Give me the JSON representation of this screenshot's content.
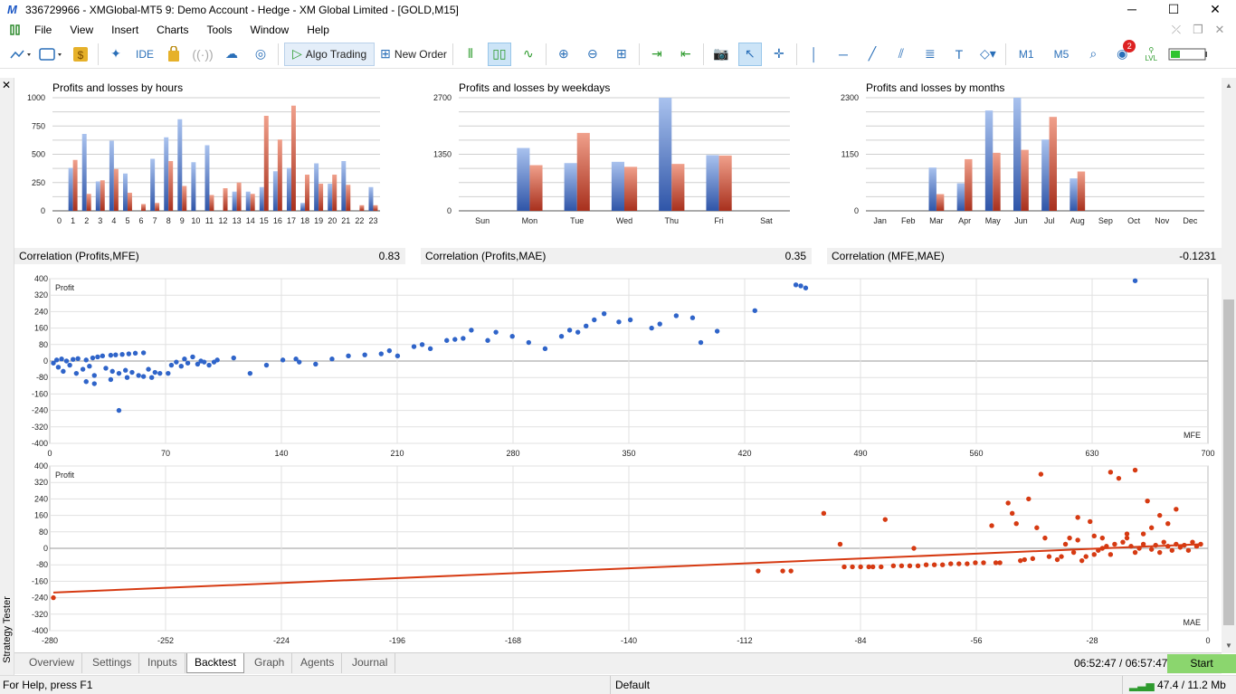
{
  "window": {
    "title": "336729966 - XMGlobal-MT5 9: Demo Account - Hedge - XM Global Limited - [GOLD,M15]",
    "controls": [
      "─",
      "☐",
      "✕"
    ]
  },
  "menu": [
    "File",
    "View",
    "Insert",
    "Charts",
    "Tools",
    "Window",
    "Help"
  ],
  "toolbar": {
    "ide": "IDE",
    "algo_trading": "Algo Trading",
    "new_order": "New Order",
    "tf1": "M1",
    "tf2": "M5",
    "notif_count": "2",
    "lvl": "LVL"
  },
  "colors": {
    "blue": "#3f6bc4",
    "red": "#c0442a",
    "scatter_blue": "#2f64c9",
    "scatter_red": "#d63a12"
  },
  "hours": {
    "title": "Profits and losses by hours",
    "yticks": [
      "1000",
      "750",
      "500",
      "250",
      "0"
    ],
    "xticks": [
      "0",
      "1",
      "2",
      "3",
      "4",
      "5",
      "6",
      "7",
      "8",
      "9",
      "10",
      "11",
      "12",
      "13",
      "14",
      "15",
      "16",
      "17",
      "18",
      "19",
      "20",
      "21",
      "22",
      "23"
    ],
    "ymax": 1000,
    "profit": [
      0,
      380,
      680,
      260,
      620,
      330,
      0,
      460,
      650,
      810,
      430,
      580,
      0,
      170,
      170,
      210,
      350,
      380,
      70,
      420,
      240,
      440,
      0,
      210
    ],
    "loss": [
      0,
      450,
      150,
      270,
      370,
      160,
      60,
      70,
      440,
      220,
      0,
      140,
      200,
      250,
      150,
      840,
      630,
      930,
      320,
      240,
      320,
      230,
      50,
      50
    ]
  },
  "weekdays": {
    "title": "Profits and losses by weekdays",
    "yticks": [
      "2700",
      "1350",
      "0"
    ],
    "xticks": [
      "Sun",
      "Mon",
      "Tue",
      "Wed",
      "Thu",
      "Fri",
      "Sat"
    ],
    "ymax": 2700,
    "profit": [
      0,
      1500,
      1140,
      1170,
      2700,
      1330,
      0
    ],
    "loss": [
      0,
      1090,
      1860,
      1050,
      1120,
      1320,
      0
    ]
  },
  "months": {
    "title": "Profits and losses by months",
    "yticks": [
      "2300",
      "1150",
      "0"
    ],
    "xticks": [
      "Jan",
      "Feb",
      "Mar",
      "Apr",
      "May",
      "Jun",
      "Jul",
      "Aug",
      "Sep",
      "Oct",
      "Nov",
      "Dec"
    ],
    "ymax": 2300,
    "profit": [
      0,
      0,
      880,
      560,
      2040,
      2300,
      1450,
      660,
      0,
      0,
      0,
      0
    ],
    "loss": [
      0,
      0,
      340,
      1050,
      1180,
      1240,
      1910,
      800,
      0,
      0,
      0,
      0
    ]
  },
  "correlations": [
    {
      "label": "Correlation (Profits,MFE)",
      "value": "0.83"
    },
    {
      "label": "Correlation (Profits,MAE)",
      "value": "0.35"
    },
    {
      "label": "Correlation (MFE,MAE)",
      "value": "-0.1231"
    }
  ],
  "mfe_chart": {
    "ylabel": "Profit",
    "xlabel": "MFE",
    "yticks": [
      "400",
      "320",
      "240",
      "160",
      "80",
      "0",
      "-80",
      "-160",
      "-240",
      "-320",
      "-400"
    ],
    "xticks": [
      "0",
      "70",
      "140",
      "210",
      "280",
      "350",
      "420",
      "490",
      "560",
      "630",
      "700"
    ]
  },
  "mae_chart": {
    "ylabel": "Profit",
    "xlabel": "MAE",
    "yticks": [
      "400",
      "320",
      "240",
      "160",
      "80",
      "0",
      "-80",
      "-160",
      "-240",
      "-320",
      "-400"
    ],
    "xticks": [
      "-280",
      "-252",
      "-224",
      "-196",
      "-168",
      "-140",
      "-112",
      "-84",
      "-56",
      "-28",
      "0"
    ]
  },
  "chart_data": [
    {
      "type": "bar",
      "title": "Profits and losses by hours",
      "categories": [
        "0",
        "1",
        "2",
        "3",
        "4",
        "5",
        "6",
        "7",
        "8",
        "9",
        "10",
        "11",
        "12",
        "13",
        "14",
        "15",
        "16",
        "17",
        "18",
        "19",
        "20",
        "21",
        "22",
        "23"
      ],
      "ylim": [
        0,
        1000
      ],
      "series": [
        {
          "values": [
            0,
            380,
            680,
            260,
            620,
            330,
            0,
            460,
            650,
            810,
            430,
            580,
            0,
            170,
            170,
            210,
            350,
            380,
            70,
            420,
            240,
            440,
            0,
            210
          ]
        },
        {
          "values": [
            0,
            450,
            150,
            270,
            370,
            160,
            60,
            70,
            440,
            220,
            0,
            140,
            200,
            250,
            150,
            840,
            630,
            930,
            320,
            240,
            320,
            230,
            50,
            50
          ]
        }
      ]
    },
    {
      "type": "bar",
      "title": "Profits and losses by weekdays",
      "categories": [
        "Sun",
        "Mon",
        "Tue",
        "Wed",
        "Thu",
        "Fri",
        "Sat"
      ],
      "ylim": [
        0,
        2700
      ],
      "series": [
        {
          "values": [
            0,
            1500,
            1140,
            1170,
            2700,
            1330,
            0
          ]
        },
        {
          "values": [
            0,
            1090,
            1860,
            1050,
            1120,
            1320,
            0
          ]
        }
      ]
    },
    {
      "type": "bar",
      "title": "Profits and losses by months",
      "categories": [
        "Jan",
        "Feb",
        "Mar",
        "Apr",
        "May",
        "Jun",
        "Jul",
        "Aug",
        "Sep",
        "Oct",
        "Nov",
        "Dec"
      ],
      "ylim": [
        0,
        2300
      ],
      "series": [
        {
          "values": [
            0,
            0,
            880,
            560,
            2040,
            2300,
            1450,
            660,
            0,
            0,
            0,
            0
          ]
        },
        {
          "values": [
            0,
            0,
            340,
            1050,
            1180,
            1240,
            1910,
            800,
            0,
            0,
            0,
            0
          ]
        }
      ]
    },
    {
      "type": "scatter",
      "xlabel": "MFE",
      "ylabel": "Profit",
      "xlim": [
        0,
        700
      ],
      "ylim": [
        -400,
        400
      ],
      "points": [
        [
          0,
          -10
        ],
        [
          2,
          5
        ],
        [
          3,
          -30
        ],
        [
          5,
          10
        ],
        [
          6,
          -50
        ],
        [
          8,
          0
        ],
        [
          10,
          -20
        ],
        [
          12,
          8
        ],
        [
          14,
          -60
        ],
        [
          15,
          12
        ],
        [
          18,
          -40
        ],
        [
          20,
          5
        ],
        [
          22,
          -25
        ],
        [
          24,
          15
        ],
        [
          25,
          -70
        ],
        [
          27,
          20
        ],
        [
          30,
          25
        ],
        [
          32,
          -35
        ],
        [
          35,
          28
        ],
        [
          36,
          -50
        ],
        [
          38,
          30
        ],
        [
          40,
          -60
        ],
        [
          42,
          32
        ],
        [
          44,
          -45
        ],
        [
          46,
          35
        ],
        [
          48,
          -55
        ],
        [
          50,
          38
        ],
        [
          52,
          -70
        ],
        [
          55,
          40
        ],
        [
          58,
          -40
        ],
        [
          60,
          -80
        ],
        [
          62,
          -55
        ],
        [
          65,
          -60
        ],
        [
          70,
          -60
        ],
        [
          72,
          -20
        ],
        [
          75,
          -5
        ],
        [
          78,
          -25
        ],
        [
          80,
          10
        ],
        [
          82,
          -10
        ],
        [
          85,
          20
        ],
        [
          88,
          -15
        ],
        [
          90,
          0
        ],
        [
          92,
          -5
        ],
        [
          95,
          -20
        ],
        [
          98,
          -5
        ],
        [
          100,
          5
        ],
        [
          110,
          15
        ],
        [
          120,
          -60
        ],
        [
          130,
          -20
        ],
        [
          140,
          5
        ],
        [
          148,
          10
        ],
        [
          150,
          -5
        ],
        [
          160,
          -15
        ],
        [
          170,
          10
        ],
        [
          180,
          25
        ],
        [
          190,
          30
        ],
        [
          200,
          35
        ],
        [
          205,
          50
        ],
        [
          210,
          25
        ],
        [
          220,
          70
        ],
        [
          225,
          80
        ],
        [
          230,
          60
        ],
        [
          240,
          100
        ],
        [
          245,
          105
        ],
        [
          250,
          110
        ],
        [
          255,
          150
        ],
        [
          265,
          100
        ],
        [
          270,
          140
        ],
        [
          280,
          120
        ],
        [
          290,
          90
        ],
        [
          300,
          60
        ],
        [
          310,
          120
        ],
        [
          315,
          150
        ],
        [
          320,
          140
        ],
        [
          325,
          170
        ],
        [
          330,
          200
        ],
        [
          336,
          230
        ],
        [
          345,
          190
        ],
        [
          352,
          200
        ],
        [
          365,
          160
        ],
        [
          370,
          180
        ],
        [
          380,
          220
        ],
        [
          390,
          210
        ],
        [
          395,
          90
        ],
        [
          405,
          145
        ],
        [
          428,
          245
        ],
        [
          453,
          370
        ],
        [
          456,
          365
        ],
        [
          459,
          355
        ],
        [
          660,
          390
        ],
        [
          40,
          -240
        ],
        [
          20,
          -100
        ],
        [
          25,
          -110
        ],
        [
          35,
          -90
        ],
        [
          45,
          -80
        ],
        [
          55,
          -75
        ]
      ]
    },
    {
      "type": "scatter",
      "xlabel": "MAE",
      "ylabel": "Profit",
      "xlim": [
        -280,
        0
      ],
      "ylim": [
        -400,
        400
      ],
      "trend": [
        [
          -280,
          -215
        ],
        [
          0,
          20
        ]
      ],
      "points": [
        [
          -280,
          -240
        ],
        [
          -108,
          -110
        ],
        [
          -102,
          -110
        ],
        [
          -100,
          -110
        ],
        [
          -92,
          170
        ],
        [
          -88,
          20
        ],
        [
          -87,
          -90
        ],
        [
          -85,
          -90
        ],
        [
          -83,
          -90
        ],
        [
          -81,
          -90
        ],
        [
          -80,
          -90
        ],
        [
          -78,
          -90
        ],
        [
          -77,
          140
        ],
        [
          -75,
          -85
        ],
        [
          -73,
          -85
        ],
        [
          -71,
          -85
        ],
        [
          -70,
          0
        ],
        [
          -69,
          -85
        ],
        [
          -67,
          -80
        ],
        [
          -65,
          -80
        ],
        [
          -63,
          -80
        ],
        [
          -61,
          -75
        ],
        [
          -59,
          -75
        ],
        [
          -57,
          -75
        ],
        [
          -55,
          -70
        ],
        [
          -53,
          -70
        ],
        [
          -51,
          110
        ],
        [
          -50,
          -70
        ],
        [
          -49,
          -70
        ],
        [
          -47,
          220
        ],
        [
          -46,
          170
        ],
        [
          -45,
          120
        ],
        [
          -44,
          -60
        ],
        [
          -43,
          -55
        ],
        [
          -42,
          240
        ],
        [
          -41,
          -50
        ],
        [
          -40,
          100
        ],
        [
          -39,
          360
        ],
        [
          -38,
          50
        ],
        [
          -37,
          -40
        ],
        [
          -35,
          -55
        ],
        [
          -34,
          -40
        ],
        [
          -33,
          20
        ],
        [
          -32,
          50
        ],
        [
          -31,
          -20
        ],
        [
          -30,
          150
        ],
        [
          -29,
          -60
        ],
        [
          -28,
          -40
        ],
        [
          -27,
          130
        ],
        [
          -26,
          -30
        ],
        [
          -25,
          -10
        ],
        [
          -24,
          0
        ],
        [
          -23,
          10
        ],
        [
          -22,
          -30
        ],
        [
          -21,
          20
        ],
        [
          -20,
          340
        ],
        [
          -19,
          30
        ],
        [
          -18,
          50
        ],
        [
          -17,
          10
        ],
        [
          -16,
          -20
        ],
        [
          -15,
          0
        ],
        [
          -14,
          20
        ],
        [
          -13,
          230
        ],
        [
          -12,
          -5
        ],
        [
          -11,
          15
        ],
        [
          -10,
          -20
        ],
        [
          -9,
          30
        ],
        [
          -8,
          10
        ],
        [
          -7,
          -10
        ],
        [
          -6,
          20
        ],
        [
          -5,
          5
        ],
        [
          -4,
          15
        ],
        [
          -3,
          -10
        ],
        [
          -2,
          30
        ],
        [
          -1,
          10
        ],
        [
          0,
          20
        ],
        [
          -22,
          370
        ],
        [
          -16,
          380
        ],
        [
          -12,
          100
        ],
        [
          -10,
          160
        ],
        [
          -8,
          120
        ],
        [
          -6,
          190
        ],
        [
          -18,
          70
        ],
        [
          -24,
          50
        ],
        [
          -26,
          60
        ],
        [
          -14,
          70
        ],
        [
          -30,
          40
        ]
      ]
    }
  ],
  "tabs": [
    "Overview",
    "Settings",
    "Inputs",
    "Backtest",
    "Graph",
    "Agents",
    "Journal"
  ],
  "active_tab": "Backtest",
  "timer": "06:52:47 / 06:57:47",
  "start_button": "Start",
  "side_label": "Strategy Tester",
  "status": {
    "help": "For Help, press F1",
    "profile": "Default",
    "net": "47.4 / 11.2 Mb"
  }
}
